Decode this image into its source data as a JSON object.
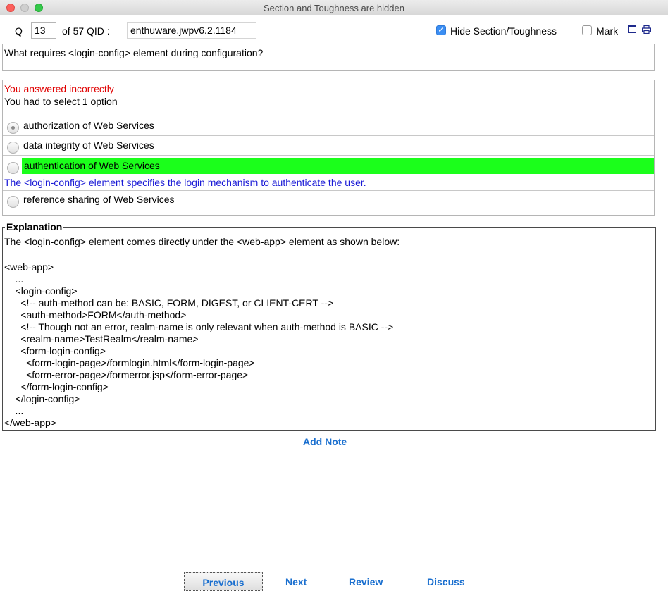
{
  "window": {
    "title": "Section and Toughness are hidden"
  },
  "toolbar": {
    "q_label": "Q",
    "q_value": "13",
    "of_label": "of 57 QID :",
    "qid_value": "enthuware.jwpv6.2.1184",
    "hide_label": "Hide Section/Toughness",
    "hide_checked": true,
    "mark_label": "Mark",
    "mark_checked": false
  },
  "question": {
    "text": "What requires <login-config> element during configuration?"
  },
  "result": {
    "status": "You answered incorrectly",
    "select_info": "You had to select 1 option"
  },
  "options": [
    {
      "label": "authorization of Web Services",
      "selected": true,
      "correct": false
    },
    {
      "label": "data integrity of Web Services",
      "selected": false,
      "correct": false
    },
    {
      "label": "authentication of Web Services",
      "selected": false,
      "correct": true
    },
    {
      "label": "reference sharing of Web Services",
      "selected": false,
      "correct": false
    }
  ],
  "option_explanation": "The <login-config> element specifies the login mechanism to authenticate the user.",
  "explanation": {
    "title": "Explanation",
    "intro": "The <login-config> element comes directly under the <web-app> element as shown below:",
    "code": [
      "<web-app>",
      "    ...",
      "    <login-config>",
      "      <!-- auth-method can be: BASIC, FORM, DIGEST, or CLIENT-CERT -->",
      "      <auth-method>FORM</auth-method>",
      "      <!-- Though not an error, realm-name is only relevant when auth-method is BASIC -->",
      "      <realm-name>TestRealm</realm-name>",
      "      <form-login-config>",
      "        <form-login-page>/formlogin.html</form-login-page>",
      "        <form-error-page>/formerror.jsp</form-error-page>",
      "      </form-login-config>",
      "    </login-config>",
      "    ...",
      "</web-app>"
    ]
  },
  "actions": {
    "add_note": "Add Note",
    "previous": "Previous",
    "next": "Next",
    "review": "Review",
    "discuss": "Discuss"
  }
}
